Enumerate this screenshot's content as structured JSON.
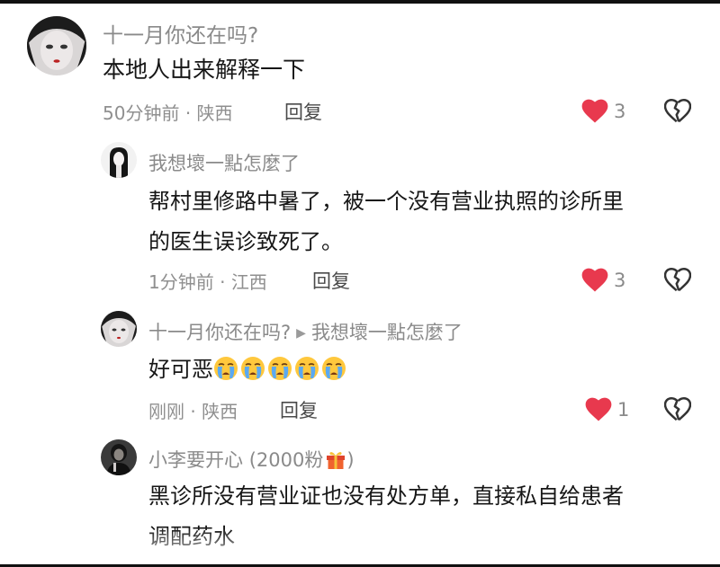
{
  "comments": [
    {
      "username": "十一月你还在吗?",
      "text": "本地人出来解释一下",
      "time": "50分钟前",
      "location": "陕西",
      "reply_label": "回复",
      "likes": "3",
      "liked": true
    },
    {
      "username": "我想壞一點怎麼了",
      "text_line1": "帮村里修路中暑了，被一个没有营业执照的诊所里",
      "text_line2": "的医生误诊致死了。",
      "time": "1分钟前",
      "location": "江西",
      "reply_label": "回复",
      "likes": "3",
      "liked": true
    },
    {
      "username": "十一月你还在吗?",
      "reply_to": "我想壞一點怎麼了",
      "text": "好可恶",
      "emoji_count": 5,
      "time": "刚刚",
      "location": "陕西",
      "reply_label": "回复",
      "likes": "1",
      "liked": true
    },
    {
      "username": "小李要开心",
      "fan_badge": "(2000粉",
      "fan_badge_end": ")",
      "text_line1": "黑诊所没有营业证也没有处方单，直接私自给患者",
      "text_line2": "调配药水"
    }
  ],
  "separator": "·",
  "colors": {
    "like_active": "#e8394e",
    "meta_text": "#8f8f8f",
    "body_text": "#161616"
  },
  "icons": {
    "like": "heart-filled-icon",
    "dislike": "broken-heart-icon",
    "emoji": "crying-face-emoji",
    "gift": "gift-box-icon"
  }
}
